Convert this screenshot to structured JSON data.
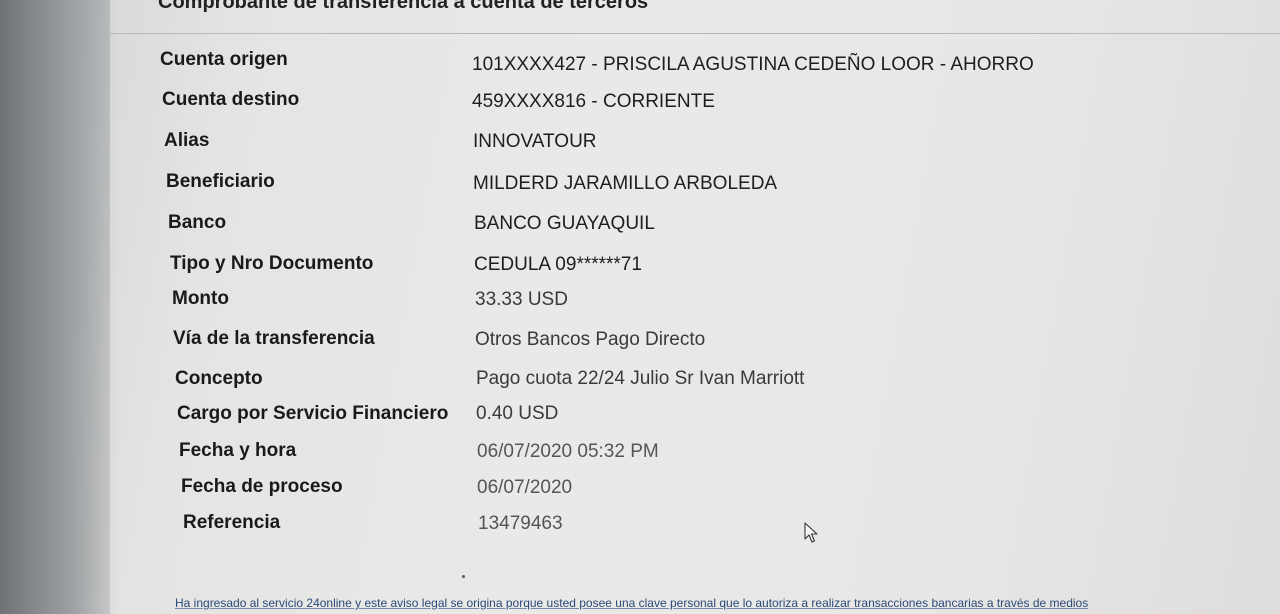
{
  "page": {
    "title": "Comprobante de transferencia a cuenta de terceros"
  },
  "rows": [
    {
      "label": "Cuenta origen",
      "value": "101XXXX427 - PRISCILA AGUSTINA CEDEÑO LOOR - AHORRO"
    },
    {
      "label": "Cuenta destino",
      "value": "459XXXX816 - CORRIENTE"
    },
    {
      "label": "Alias",
      "value": "INNOVATOUR"
    },
    {
      "label": "Beneficiario",
      "value": "MILDERD JARAMILLO ARBOLEDA"
    },
    {
      "label": "Banco",
      "value": "BANCO GUAYAQUIL"
    },
    {
      "label": "Tipo y Nro Documento",
      "value": "CEDULA 09******71"
    },
    {
      "label": "Monto",
      "value": "33.33 USD"
    },
    {
      "label": "Vía de la transferencia",
      "value": "Otros Bancos Pago Directo"
    },
    {
      "label": "Concepto",
      "value": "Pago cuota 22/24 Julio Sr  Ivan Marriott"
    },
    {
      "label": "Cargo por Servicio Financiero",
      "value": "0.40 USD"
    },
    {
      "label": "Fecha y hora",
      "value": "06/07/2020 05:32 PM"
    },
    {
      "label": "Fecha de proceso",
      "value": "06/07/2020"
    },
    {
      "label": "Referencia",
      "value": "13479463"
    }
  ],
  "footer": {
    "note": "Ha ingresado al servicio 24online y este aviso legal se origina porque usted posee una clave personal que lo autoriza a realizar transacciones bancarias a través de medios"
  },
  "icons": {
    "cursor": "mouse-pointer-icon"
  }
}
